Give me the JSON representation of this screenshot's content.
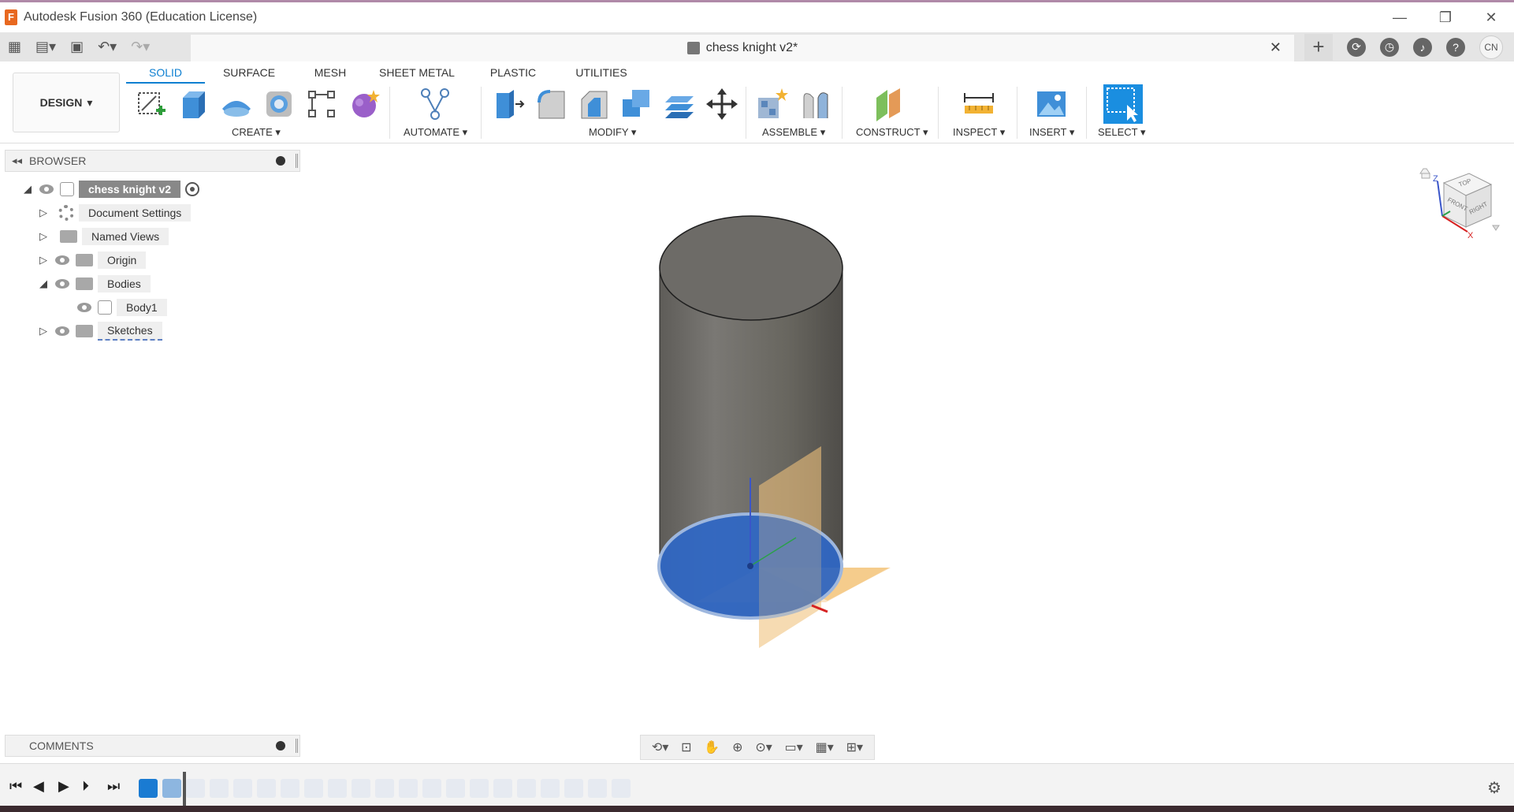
{
  "window": {
    "title": "Autodesk Fusion 360 (Education License)",
    "minimize_glyph": "—",
    "restore_glyph": "❐",
    "close_glyph": "✕"
  },
  "document": {
    "name": "chess knight v2*",
    "close_glyph": "✕"
  },
  "user": {
    "initials": "CN"
  },
  "quick_access": {
    "grid_icon": "grid-icon",
    "file_icon": "file-icon",
    "save_icon": "save-icon",
    "undo_icon": "undo-icon",
    "redo_icon": "redo-icon"
  },
  "workspace": {
    "label": "DESIGN"
  },
  "ribbon": {
    "tabs": [
      {
        "label": "SOLID",
        "active": true
      },
      {
        "label": "SURFACE",
        "active": false
      },
      {
        "label": "MESH",
        "active": false
      },
      {
        "label": "SHEET METAL",
        "active": false
      },
      {
        "label": "PLASTIC",
        "active": false
      },
      {
        "label": "UTILITIES",
        "active": false
      }
    ],
    "groups": {
      "create": "CREATE ▾",
      "automate": "AUTOMATE ▾",
      "modify": "MODIFY ▾",
      "assemble": "ASSEMBLE ▾",
      "construct": "CONSTRUCT ▾",
      "inspect": "INSPECT ▾",
      "insert": "INSERT ▾",
      "select": "SELECT ▾"
    }
  },
  "browser": {
    "header": "BROWSER",
    "root": "chess knight v2",
    "items": [
      {
        "label": "Document Settings",
        "icon": "gear-icon"
      },
      {
        "label": "Named Views",
        "icon": "folder-icon"
      },
      {
        "label": "Origin",
        "icon": "folder-icon"
      },
      {
        "label": "Bodies",
        "icon": "folder-icon"
      },
      {
        "label": "Body1",
        "icon": "body-icon"
      },
      {
        "label": "Sketches",
        "icon": "folder-icon"
      }
    ]
  },
  "comments": {
    "header": "COMMENTS"
  },
  "viewcube": {
    "top": "TOP",
    "front": "FRONT",
    "right": "RIGHT",
    "z": "Z",
    "x": "X"
  },
  "colors": {
    "accent": "#0d7fd1",
    "body": "#6f6d68",
    "sketch_blue": "#2f67c6",
    "plane_orange": "#f0b85e"
  }
}
